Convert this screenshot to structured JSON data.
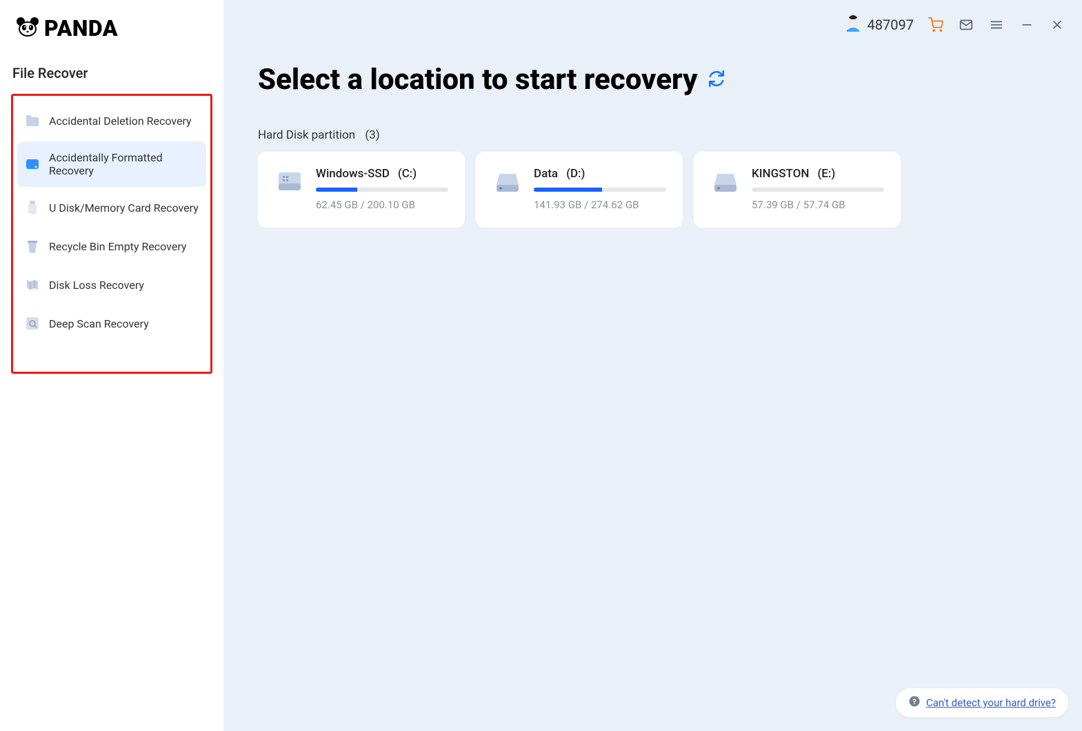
{
  "app": {
    "name": "PANDA"
  },
  "toolbar": {
    "user_id": "487097"
  },
  "sidebar": {
    "title": "File Recover",
    "items": [
      {
        "label": "Accidental Deletion Recovery",
        "icon": "folder-icon",
        "active": false
      },
      {
        "label": "Accidentally Formatted Recovery",
        "icon": "drive-blue-icon",
        "active": true
      },
      {
        "label": "U Disk/Memory Card Recovery",
        "icon": "usb-icon",
        "active": false
      },
      {
        "label": "Recycle Bin Empty Recovery",
        "icon": "recycle-bin-icon",
        "active": false
      },
      {
        "label": "Disk Loss Recovery",
        "icon": "map-icon",
        "active": false
      },
      {
        "label": "Deep Scan Recovery",
        "icon": "scan-icon",
        "active": false
      }
    ]
  },
  "main": {
    "title": "Select a location to start recovery",
    "section_label": "Hard Disk partition",
    "section_count": "(3)",
    "drives": [
      {
        "name": "Windows-SSD",
        "letter": "(C:)",
        "used": "62.45 GB",
        "total": "200.10 GB",
        "usage_text": "62.45 GB / 200.10 GB",
        "percent": 31.2,
        "type": "system"
      },
      {
        "name": "Data",
        "letter": "(D:)",
        "used": "141.93 GB",
        "total": "274.62 GB",
        "usage_text": "141.93 GB / 274.62 GB",
        "percent": 51.7,
        "type": "hdd"
      },
      {
        "name": "KINGSTON",
        "letter": "(E:)",
        "used": "57.39 GB",
        "total": "57.74 GB",
        "usage_text": "57.39 GB / 57.74 GB",
        "percent": 0,
        "type": "hdd"
      }
    ]
  },
  "help": {
    "link_text": "Can't detect your hard drive?"
  }
}
